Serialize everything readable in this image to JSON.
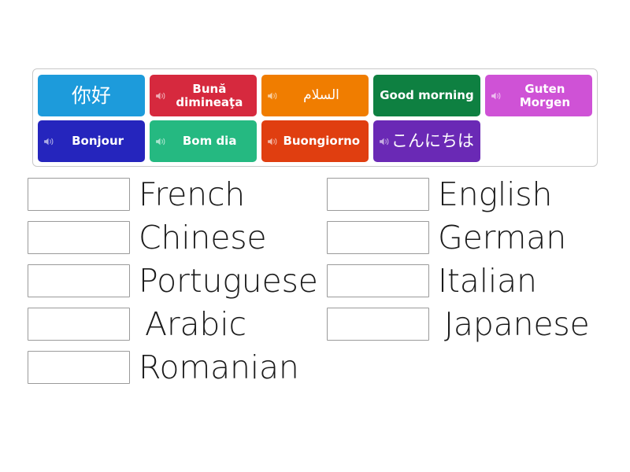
{
  "activity": {
    "type": "match-up-quiz",
    "title": "Language greetings match-up"
  },
  "tiles": {
    "icon_name": "speaker-icon",
    "rows": [
      [
        {
          "text": "你好",
          "lang": "Chinese",
          "color": "#1d9bdb",
          "has_speaker": false,
          "style": "cjk"
        },
        {
          "text": "Bună dimineaţa",
          "lang": "Romanian",
          "color": "#d6293e",
          "has_speaker": true,
          "style": "latin"
        },
        {
          "text": "السلام",
          "lang": "Arabic",
          "color": "#f07d00",
          "has_speaker": true,
          "style": "arabic"
        },
        {
          "text": "Good morning",
          "lang": "English",
          "color": "#0e8041",
          "has_speaker": false,
          "style": "latin"
        },
        {
          "text": "Guten Morgen",
          "lang": "German",
          "color": "#cf52d6",
          "has_speaker": true,
          "style": "latin"
        }
      ],
      [
        {
          "text": "Bonjour",
          "lang": "French",
          "color": "#2525bd",
          "has_speaker": true,
          "style": "latin"
        },
        {
          "text": "Bom dia",
          "lang": "Portuguese",
          "color": "#25b981",
          "has_speaker": true,
          "style": "latin"
        },
        {
          "text": "Buongiorno",
          "lang": "Italian",
          "color": "#e03e10",
          "has_speaker": true,
          "style": "latin"
        },
        {
          "text": "こんにちは",
          "lang": "Japanese",
          "color": "#6a29b5",
          "has_speaker": true,
          "style": "cjk-sm"
        }
      ]
    ]
  },
  "answers": {
    "left_column": [
      {
        "label": "French",
        "value": ""
      },
      {
        "label": "Chinese",
        "value": ""
      },
      {
        "label": "Portuguese",
        "value": ""
      },
      {
        "label": "Arabic",
        "value": ""
      },
      {
        "label": "Romanian",
        "value": ""
      }
    ],
    "right_column": [
      {
        "label": "English",
        "value": ""
      },
      {
        "label": "German",
        "value": ""
      },
      {
        "label": "Italian",
        "value": ""
      },
      {
        "label": "Japanese",
        "value": ""
      }
    ]
  },
  "colors": {
    "background": "#ffffff",
    "tray_border": "#c8c8c8",
    "drop_box_border": "#9a9a9a",
    "answer_text": "#1b1b1b"
  }
}
